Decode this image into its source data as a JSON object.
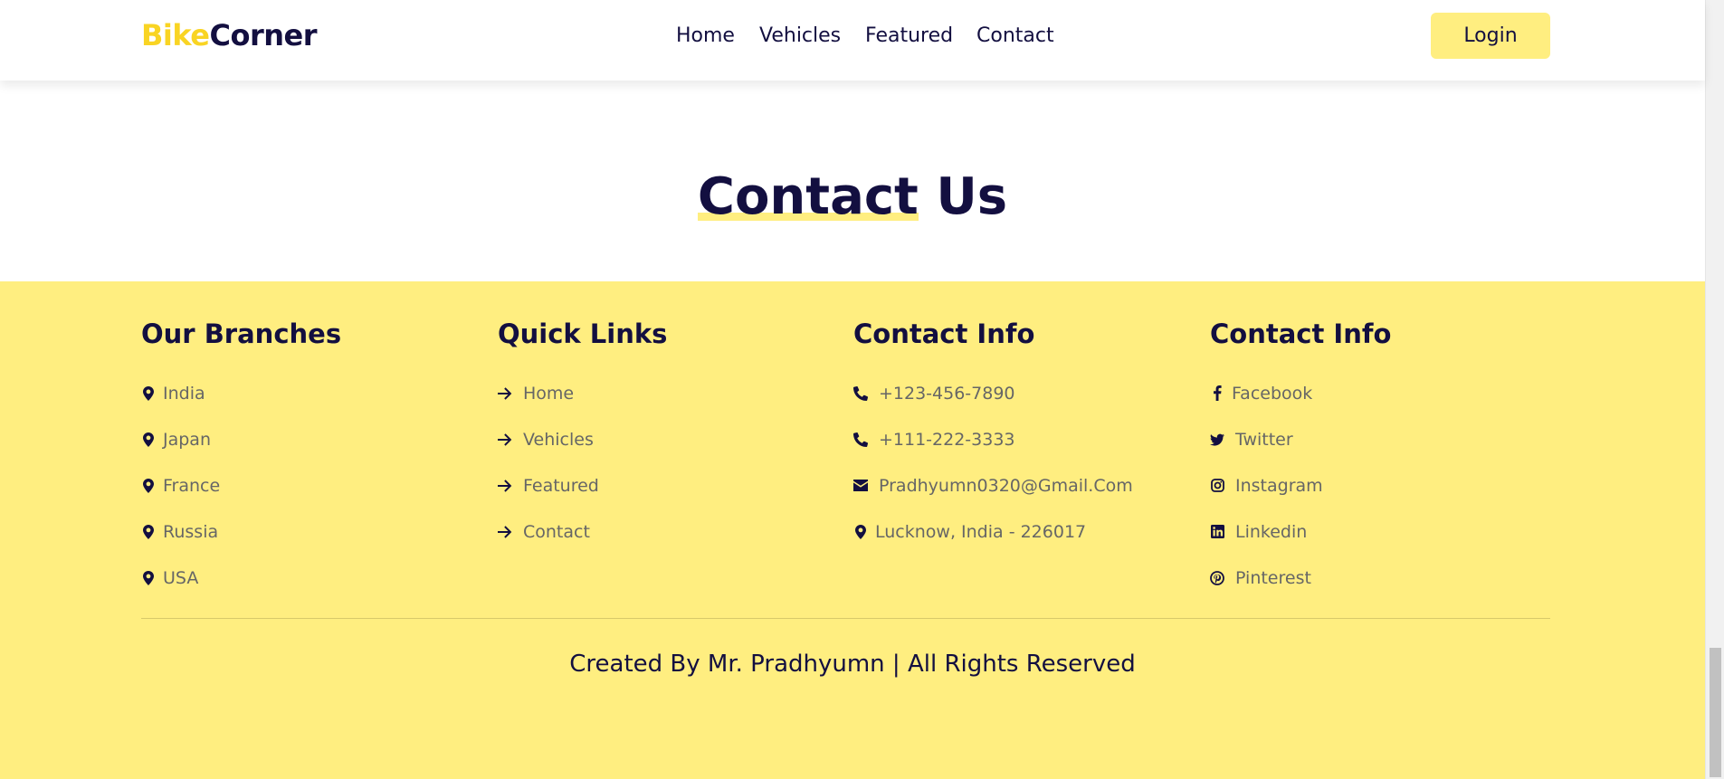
{
  "header": {
    "logo_accent": "Bike",
    "logo_rest": "Corner",
    "nav": [
      "Home",
      "Vehicles",
      "Featured",
      "Contact"
    ],
    "login_label": "Login"
  },
  "contact": {
    "heading_underlined": "Contact",
    "heading_rest": " Us"
  },
  "footer": {
    "branches": {
      "title": "Our Branches",
      "items": [
        "India",
        "Japan",
        "France",
        "Russia",
        "USA"
      ]
    },
    "quick_links": {
      "title": "Quick Links",
      "items": [
        "Home",
        "Vehicles",
        "Featured",
        "Contact"
      ]
    },
    "contact_info": {
      "title": "Contact Info",
      "items": [
        {
          "icon": "phone-icon",
          "text": "+123-456-7890"
        },
        {
          "icon": "phone-icon",
          "text": "+111-222-3333"
        },
        {
          "icon": "envelope-icon",
          "text": "Pradhyumn0320@Gmail.Com"
        },
        {
          "icon": "map-marker-icon",
          "text": "Lucknow, India - 226017"
        }
      ]
    },
    "social": {
      "title": "Contact Info",
      "items": [
        {
          "icon": "facebook-icon",
          "text": "Facebook"
        },
        {
          "icon": "twitter-icon",
          "text": "Twitter"
        },
        {
          "icon": "instagram-icon",
          "text": "Instagram"
        },
        {
          "icon": "linkedin-icon",
          "text": "Linkedin"
        },
        {
          "icon": "pinterest-icon",
          "text": "Pinterest"
        }
      ]
    },
    "credit": "Created By Mr. Pradhyumn | All Rights Reserved"
  },
  "colors": {
    "accent": "#f9d423",
    "dark": "#130f40",
    "footer_bg": "#ffee80",
    "muted_text": "#666666"
  }
}
